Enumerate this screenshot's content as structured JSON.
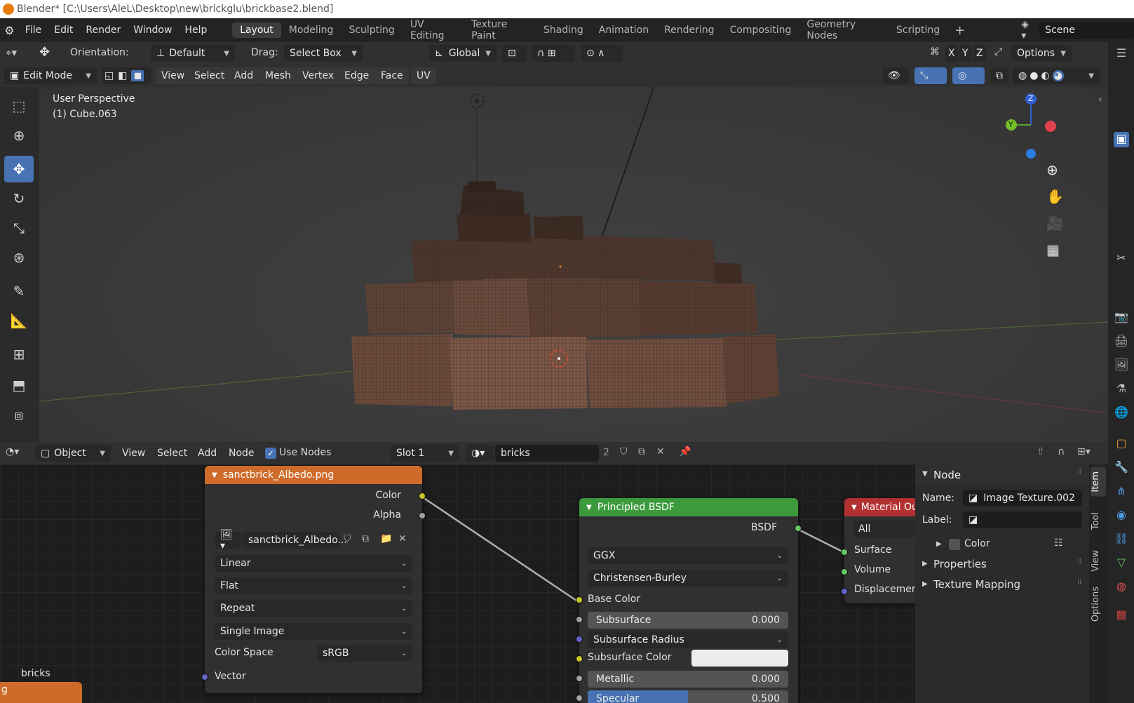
{
  "window": {
    "title": "Blender* [C:\\Users\\AleL\\Desktop\\new\\brickglu\\brickbase2.blend]"
  },
  "menu": [
    "File",
    "Edit",
    "Render",
    "Window",
    "Help"
  ],
  "workspaces": [
    {
      "label": "Layout",
      "active": true
    },
    {
      "label": "Modeling"
    },
    {
      "label": "Sculpting"
    },
    {
      "label": "UV Editing"
    },
    {
      "label": "Texture Paint"
    },
    {
      "label": "Shading"
    },
    {
      "label": "Animation"
    },
    {
      "label": "Rendering"
    },
    {
      "label": "Compositing"
    },
    {
      "label": "Geometry Nodes"
    },
    {
      "label": "Scripting"
    }
  ],
  "scene": "Scene",
  "tool_header": {
    "orientation_label": "Orientation:",
    "orientation_value": "Default",
    "drag_label": "Drag:",
    "drag_value": "Select Box",
    "transform_space": "Global",
    "x": "X",
    "y": "Y",
    "z": "Z",
    "options": "Options"
  },
  "viewport_header": {
    "mode": "Edit Mode",
    "menus": [
      "View",
      "Select",
      "Add",
      "Mesh",
      "Vertex",
      "Edge",
      "Face",
      "UV"
    ]
  },
  "viewport": {
    "perspective": "User Perspective",
    "object": "(1) Cube.063",
    "gizmo": {
      "z": "Z",
      "y": "Y"
    }
  },
  "node_header": {
    "type": "Object",
    "menus": [
      "View",
      "Select",
      "Add",
      "Node"
    ],
    "use_nodes": "Use Nodes",
    "slot": "Slot 1",
    "material": "bricks",
    "users": "2"
  },
  "image_node": {
    "title": "sanctbrick_Albedo.png",
    "out_color": "Color",
    "out_alpha": "Alpha",
    "image_name": "sanctbrick_Albedo...",
    "interpolation": "Linear",
    "projection": "Flat",
    "extension": "Repeat",
    "source": "Single Image",
    "color_space_label": "Color Space",
    "color_space": "sRGB",
    "in_vector": "Vector"
  },
  "bsdf_node": {
    "title": "Principled BSDF",
    "out": "BSDF",
    "distribution": "GGX",
    "subsurface_method": "Christensen-Burley",
    "base_color": "Base Color",
    "subsurface_label": "Subsurface",
    "subsurface_value": "0.000",
    "subsurface_radius": "Subsurface Radius",
    "subsurface_color": "Subsurface Color",
    "metallic_label": "Metallic",
    "metallic_value": "0.000",
    "specular_label": "Specular",
    "specular_value": "0.500",
    "specular_fraction": 0.5
  },
  "output_node": {
    "title": "Material Ou",
    "target": "All",
    "surface": "Surface",
    "volume": "Volume",
    "displacement": "Displacement"
  },
  "frame_label": "bricks",
  "frame_node_fragment": "g",
  "npanel": {
    "section": "Node",
    "name_label": "Name:",
    "name_value": "Image Texture.002",
    "label_label": "Label:",
    "color": "Color",
    "properties": "Properties",
    "texture_mapping": "Texture Mapping",
    "tabs": [
      "Item",
      "Tool",
      "View",
      "Options"
    ]
  },
  "colors": {
    "accent": "#4772b3",
    "image_node_header": "#cf6b2a",
    "bsdf_node_header": "#3c9a3c",
    "output_node_header": "#b23030"
  }
}
